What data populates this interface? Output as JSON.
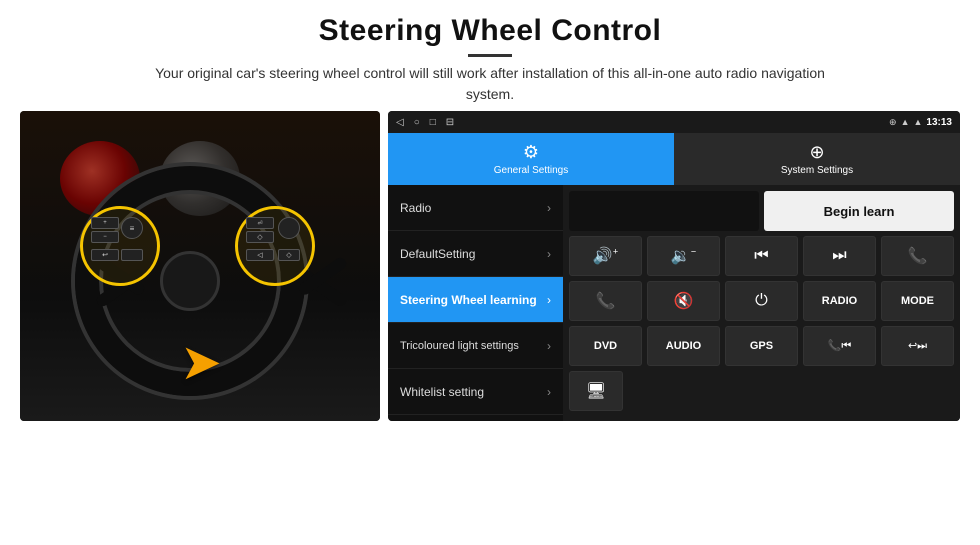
{
  "header": {
    "title": "Steering Wheel Control",
    "subtitle": "Your original car's steering wheel control will still work after installation of this all-in-one auto radio navigation system."
  },
  "status_bar": {
    "time": "13:13",
    "icons": [
      "◁",
      "○",
      "□",
      "⊟"
    ]
  },
  "tabs": [
    {
      "id": "general",
      "label": "General Settings",
      "active": true
    },
    {
      "id": "system",
      "label": "System Settings",
      "active": false
    }
  ],
  "menu_items": [
    {
      "id": "radio",
      "label": "Radio",
      "active": false
    },
    {
      "id": "default",
      "label": "DefaultSetting",
      "active": false
    },
    {
      "id": "steering",
      "label": "Steering Wheel learning",
      "active": true
    },
    {
      "id": "tricoloured",
      "label": "Tricoloured light settings",
      "active": false
    },
    {
      "id": "whitelist",
      "label": "Whitelist setting",
      "active": false
    }
  ],
  "controls": {
    "begin_learn": "Begin learn",
    "rows": [
      [
        "🔊+",
        "🔊−",
        "⏮",
        "⏭",
        "📞"
      ],
      [
        "📞↩",
        "🔇✕",
        "⏻",
        "RADIO",
        "MODE"
      ],
      [
        "DVD",
        "AUDIO",
        "GPS",
        "📞⏮",
        "↩⏭"
      ]
    ]
  }
}
